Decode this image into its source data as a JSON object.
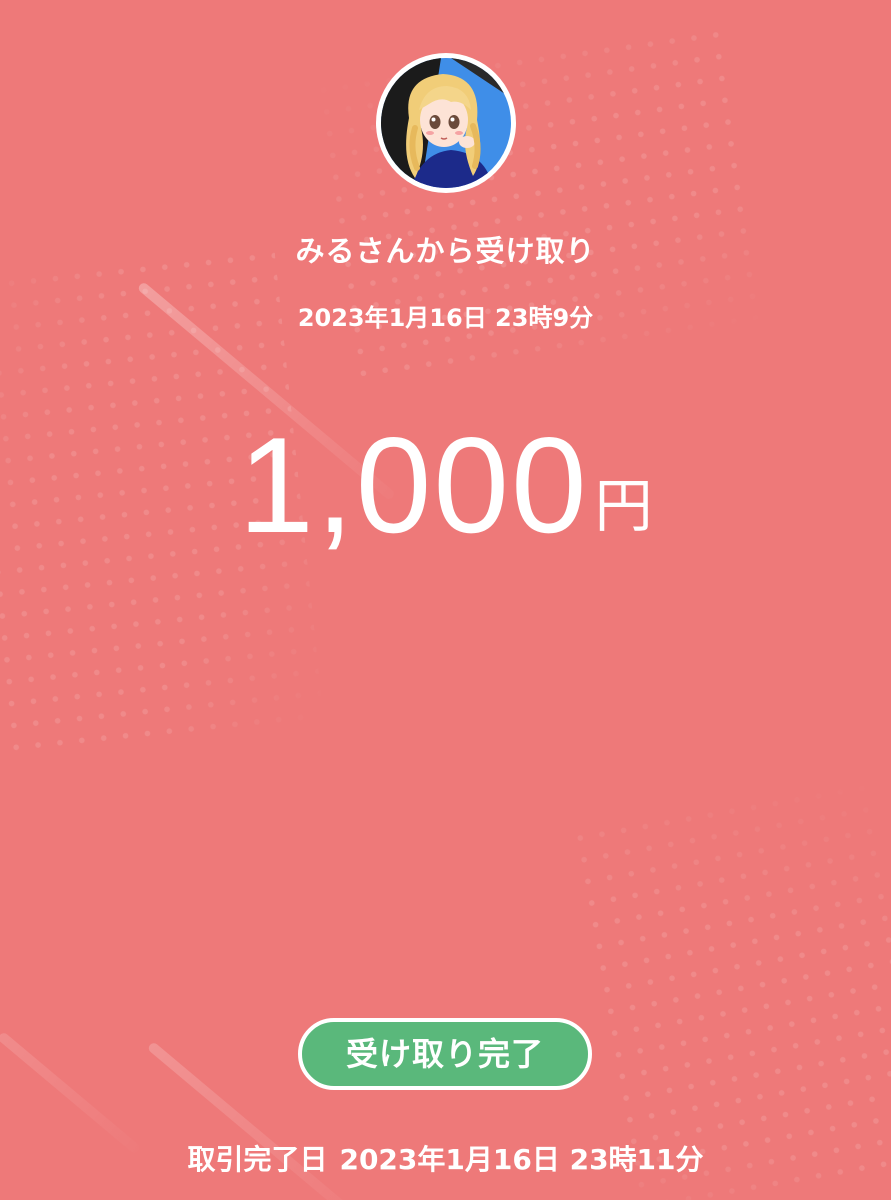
{
  "transfer": {
    "sender_line": "みるさんから受け取り",
    "sent_datetime": "2023年1月16日 23時9分",
    "amount": "1,000",
    "currency": "円",
    "status_label": "受け取り完了",
    "completion_label": "取引完了日",
    "completion_datetime": "2023年1月16日 23時11分"
  },
  "avatar": {
    "icon": "user-avatar-anime-girl"
  },
  "colors": {
    "background": "#ee7979",
    "status_green": "#5ab87b",
    "text": "#ffffff"
  }
}
